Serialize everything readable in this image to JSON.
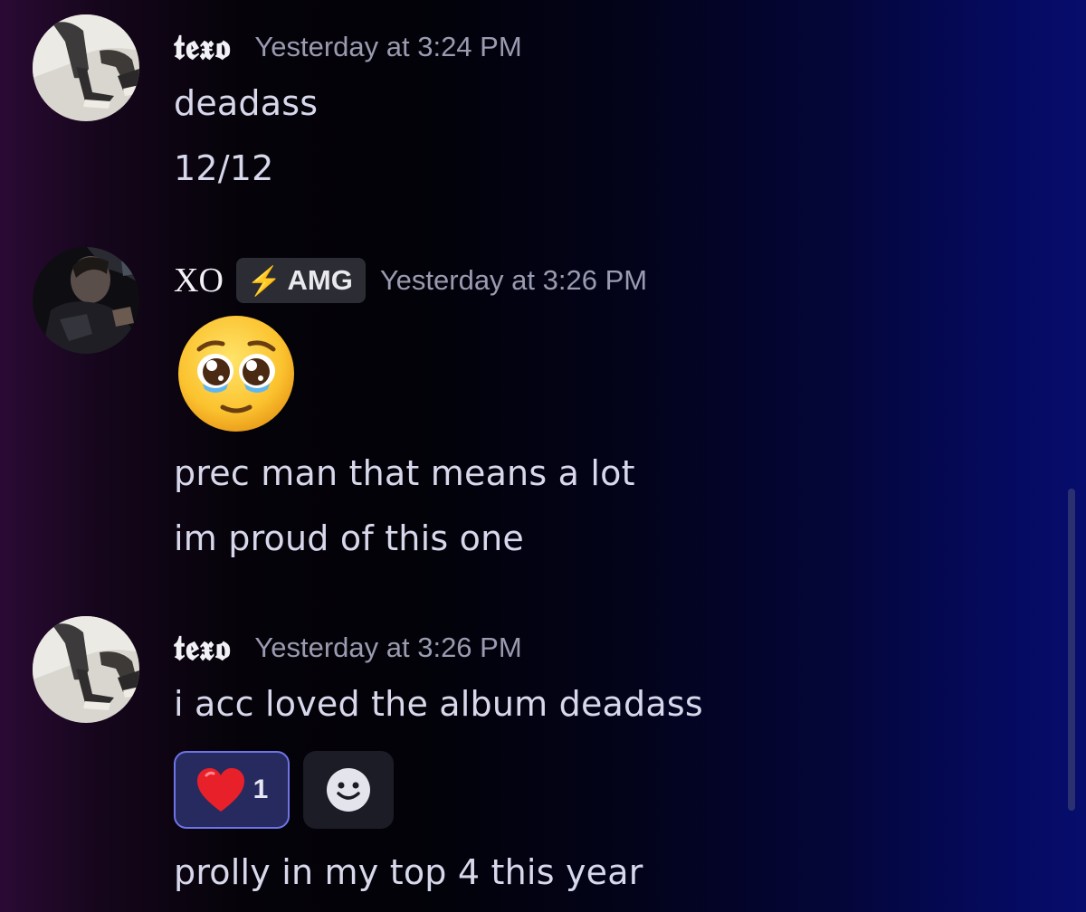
{
  "messages": [
    {
      "username": "𝖙𝖊𝖝𝖔",
      "timestamp": "Yesterday at 3:24 PM",
      "lines": [
        "deadass",
        "12/12"
      ]
    },
    {
      "username": "XO",
      "tag": "AMG",
      "timestamp": "Yesterday at 3:26 PM",
      "emoji": "pleading-face",
      "lines": [
        "prec man that means a lot",
        "im proud of this one"
      ]
    },
    {
      "username": "𝖙𝖊𝖝𝖔",
      "timestamp": "Yesterday at 3:26 PM",
      "lines": [
        "i acc loved the album deadass",
        "prolly in my top 4 this year"
      ],
      "reactions": [
        {
          "emoji": "red-heart",
          "count": "1"
        }
      ],
      "add_reaction_icon": "smiley-add-reaction-icon"
    }
  ],
  "colors": {
    "reaction_active_border": "#6e74e8",
    "reaction_active_bg": "#262a5e",
    "timestamp": "#9a9ab0"
  }
}
